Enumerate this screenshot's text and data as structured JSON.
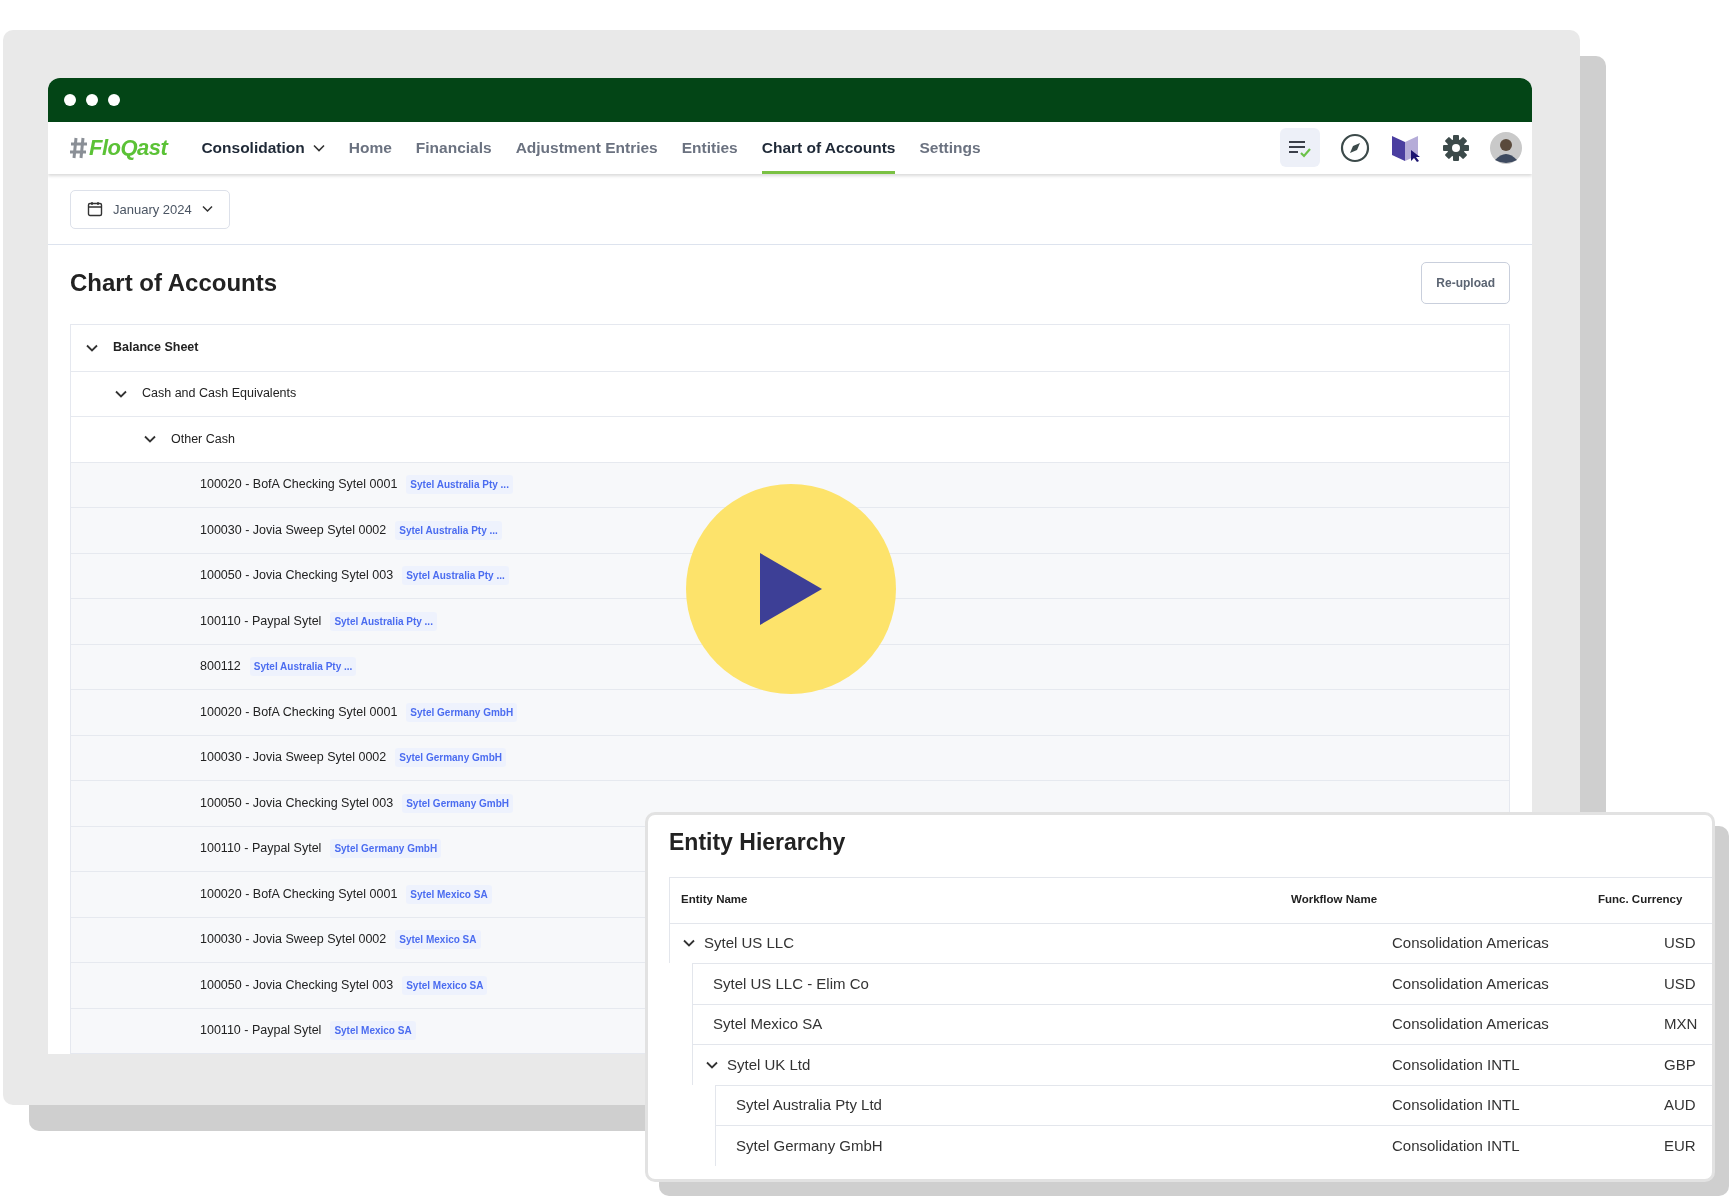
{
  "app": {
    "brand": "FloQast",
    "nav": [
      {
        "label": "Consolidation",
        "kind": "dropdown",
        "selected": false
      },
      {
        "label": "Home",
        "kind": "link",
        "selected": false
      },
      {
        "label": "Financials",
        "kind": "link",
        "selected": false
      },
      {
        "label": "Adjustment Entries",
        "kind": "link",
        "selected": false
      },
      {
        "label": "Entities",
        "kind": "link",
        "selected": false
      },
      {
        "label": "Chart of Accounts",
        "kind": "link",
        "selected": true
      },
      {
        "label": "Settings",
        "kind": "link",
        "selected": false
      }
    ],
    "date_picker": {
      "value": "January 2024"
    },
    "page_title": "Chart of Accounts",
    "reupload_button": "Re-upload",
    "accounts": [
      {
        "label": "Balance Sheet",
        "expanded": true,
        "children": [
          {
            "label": "Cash and Cash Equivalents",
            "expanded": true,
            "children": [
              {
                "label": "Other Cash",
                "expanded": true,
                "children": [
                  {
                    "label": "100020 - BofA Checking Sytel 0001",
                    "entity": "Sytel Australia Pty ..."
                  },
                  {
                    "label": "100030 - Jovia Sweep Sytel 0002",
                    "entity": "Sytel Australia Pty ..."
                  },
                  {
                    "label": "100050 - Jovia Checking Sytel 003",
                    "entity": "Sytel Australia Pty ..."
                  },
                  {
                    "label": "100110 - Paypal Sytel",
                    "entity": "Sytel Australia Pty ..."
                  },
                  {
                    "label": "800112",
                    "entity": "Sytel Australia Pty ..."
                  },
                  {
                    "label": "100020 - BofA Checking Sytel 0001",
                    "entity": "Sytel Germany GmbH"
                  },
                  {
                    "label": "100030 - Jovia Sweep Sytel 0002",
                    "entity": "Sytel Germany GmbH"
                  },
                  {
                    "label": "100050 - Jovia Checking Sytel 003",
                    "entity": "Sytel Germany GmbH"
                  },
                  {
                    "label": "100110 - Paypal Sytel",
                    "entity": "Sytel Germany GmbH"
                  },
                  {
                    "label": "100020 - BofA Checking Sytel 0001",
                    "entity": "Sytel Mexico SA"
                  },
                  {
                    "label": "100030 - Jovia Sweep Sytel 0002",
                    "entity": "Sytel Mexico SA"
                  },
                  {
                    "label": "100050 - Jovia Checking Sytel 003",
                    "entity": "Sytel Mexico SA"
                  },
                  {
                    "label": "100110 - Paypal Sytel",
                    "entity": "Sytel Mexico SA"
                  }
                ]
              }
            ]
          }
        ]
      }
    ]
  },
  "entity_hierarchy": {
    "title": "Entity Hierarchy",
    "columns": [
      "Entity Name",
      "Workflow Name",
      "Func. Currency"
    ],
    "rows": [
      {
        "name": "Sytel US LLC",
        "workflow": "Consolidation Americas",
        "currency": "USD",
        "expanded": true,
        "children": [
          {
            "name": "Sytel US LLC - Elim Co",
            "workflow": "Consolidation Americas",
            "currency": "USD"
          },
          {
            "name": "Sytel Mexico SA",
            "workflow": "Consolidation Americas",
            "currency": "MXN"
          },
          {
            "name": "Sytel UK Ltd",
            "workflow": "Consolidation INTL",
            "currency": "GBP",
            "expanded": true,
            "children": [
              {
                "name": "Sytel Australia Pty Ltd",
                "workflow": "Consolidation INTL",
                "currency": "AUD"
              },
              {
                "name": "Sytel Germany GmbH",
                "workflow": "Consolidation INTL",
                "currency": "EUR"
              }
            ]
          }
        ]
      }
    ]
  }
}
